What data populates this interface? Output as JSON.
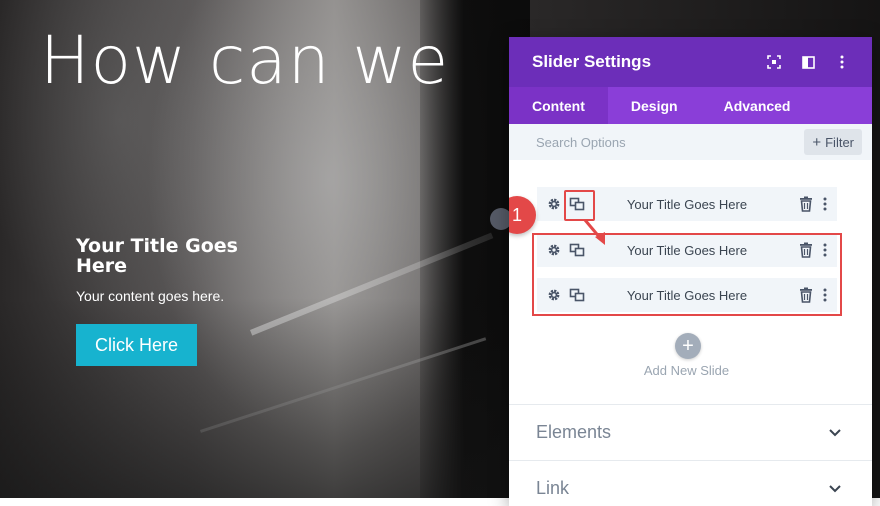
{
  "hero": {
    "heading": "How can we",
    "slide_title": "Your Title Goes Here",
    "slide_content": "Your content goes here.",
    "button_label": "Click Here"
  },
  "panel": {
    "title": "Slider Settings",
    "header_icons": [
      "focus-icon",
      "sidebar-icon",
      "kebab-menu-icon"
    ],
    "tabs": [
      {
        "label": "Content",
        "active": true
      },
      {
        "label": "Design",
        "active": false
      },
      {
        "label": "Advanced",
        "active": false
      }
    ],
    "search": {
      "placeholder": "Search Options"
    },
    "filter_label": "Filter",
    "slides": [
      {
        "label": "Your Title Goes Here"
      },
      {
        "label": "Your Title Goes Here"
      },
      {
        "label": "Your Title Goes Here"
      }
    ],
    "annotation_number": "1",
    "add_new_slide": "Add New Slide",
    "sections": [
      {
        "label": "Elements"
      },
      {
        "label": "Link"
      }
    ]
  },
  "colors": {
    "header_purple": "#6c2eb9",
    "tab_purple": "#8a3ed8",
    "accent_teal": "#17b3cf",
    "highlight_red": "#e34848"
  }
}
